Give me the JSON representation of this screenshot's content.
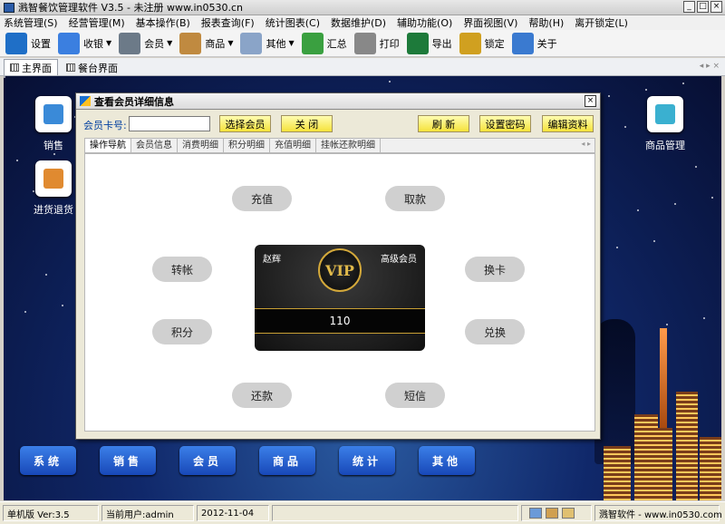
{
  "window": {
    "title": "溅智餐饮管理软件 V3.5  - 未注册 www.in0530.cn"
  },
  "menu": [
    "系统管理(S)",
    "经营管理(M)",
    "基本操作(B)",
    "报表查询(F)",
    "统计图表(C)",
    "数据维护(D)",
    "辅助功能(O)",
    "界面视图(V)",
    "帮助(H)",
    "离开锁定(L)"
  ],
  "toolbar": [
    {
      "label": "设置",
      "icon": "monitor-icon",
      "color": "#1f6fc7",
      "arrow": false
    },
    {
      "label": "收银",
      "icon": "cash-register-icon",
      "color": "#3b7fe0",
      "arrow": true
    },
    {
      "label": "会员",
      "icon": "member-card-icon",
      "color": "#6c7a88",
      "arrow": true
    },
    {
      "label": "商品",
      "icon": "goods-box-icon",
      "color": "#c08a40",
      "arrow": true
    },
    {
      "label": "其他",
      "icon": "calculator-icon",
      "color": "#8aa4c8",
      "arrow": true
    },
    {
      "label": "汇总",
      "icon": "pie-chart-icon",
      "color": "#3aa040",
      "arrow": false
    },
    {
      "label": "打印",
      "icon": "printer-icon",
      "color": "#888888",
      "arrow": false
    },
    {
      "label": "导出",
      "icon": "excel-icon",
      "color": "#1d7a3a",
      "arrow": false
    },
    {
      "label": "锁定",
      "icon": "lock-icon",
      "color": "#d0a020",
      "arrow": false
    },
    {
      "label": "关于",
      "icon": "computer-icon",
      "color": "#3a7ad0",
      "arrow": false
    }
  ],
  "tabs": [
    "主界面",
    "餐台界面"
  ],
  "desktop": {
    "icons_left": [
      {
        "label": "销售",
        "icon": "sales-icon",
        "color": "#3a8ad8"
      },
      {
        "label": "进货退货",
        "icon": "purchase-return-icon",
        "color": "#e08a30"
      }
    ],
    "icons_right": [
      {
        "label": "商品管理",
        "icon": "goods-manage-icon",
        "color": "#3ab0d0"
      }
    ],
    "bottom_buttons": [
      "系统",
      "销售",
      "会员",
      "商品",
      "统计",
      "其他"
    ]
  },
  "dialog": {
    "title": "查看会员详细信息",
    "card_label": "会员卡号:",
    "card_value": "",
    "buttons": {
      "select": "选择会员",
      "close": "关 闭",
      "refresh": "刷 新",
      "set_password": "设置密码",
      "edit": "编辑资料"
    },
    "tabs": [
      "操作导航",
      "会员信息",
      "消费明细",
      "积分明细",
      "充值明细",
      "挂帐还款明细"
    ],
    "actions": [
      "充值",
      "取款",
      "转帐",
      "换卡",
      "积分",
      "兑换",
      "还款",
      "短信"
    ],
    "card": {
      "name": "赵辉",
      "level": "高级会员",
      "badge": "VIP",
      "number": "110"
    }
  },
  "status": {
    "edition": "单机版 Ver:3.5",
    "user": "当前用户:admin",
    "date": "2012-11-04",
    "brand": "溅智软件 - www.in0530.com"
  }
}
